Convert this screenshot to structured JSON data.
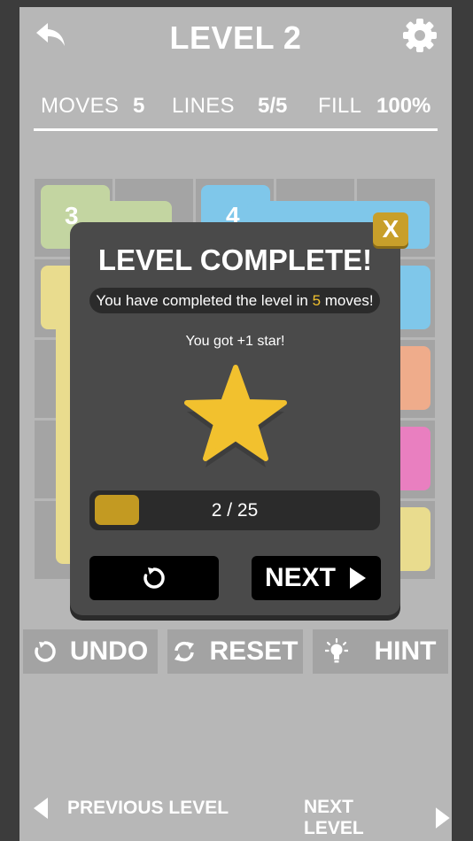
{
  "header": {
    "title": "LEVEL 2",
    "back_icon": "undo-arrow-icon",
    "settings_icon": "gear-icon"
  },
  "stats": {
    "moves_label": "MOVES",
    "moves_value": "5",
    "lines_label": "LINES",
    "lines_value": "5/5",
    "fill_label": "FILL",
    "fill_value": "100%"
  },
  "board": {
    "visible_numbers": [
      "3",
      "4"
    ],
    "colors": {
      "green": "#c3d5a1",
      "blue": "#7fc7ea",
      "yellow": "#e9dc8e",
      "orange": "#efac8b",
      "pink": "#e97fc0"
    }
  },
  "modal": {
    "title": "LEVEL COMPLETE!",
    "close_label": "X",
    "message_prefix": "You have completed the level in ",
    "message_moves": "5",
    "message_suffix": " moves!",
    "star_text": "You got +1 star!",
    "progress_text": "2 / 25",
    "progress_value": 0.08,
    "next_label": "NEXT",
    "replay_icon": "replay-icon",
    "accent": "#f2c12e"
  },
  "actions": {
    "undo_label": "UNDO",
    "reset_label": "RESET",
    "hint_label": "HINT"
  },
  "nav": {
    "prev_label": "PREVIOUS LEVEL",
    "next_label": "NEXT LEVEL"
  }
}
